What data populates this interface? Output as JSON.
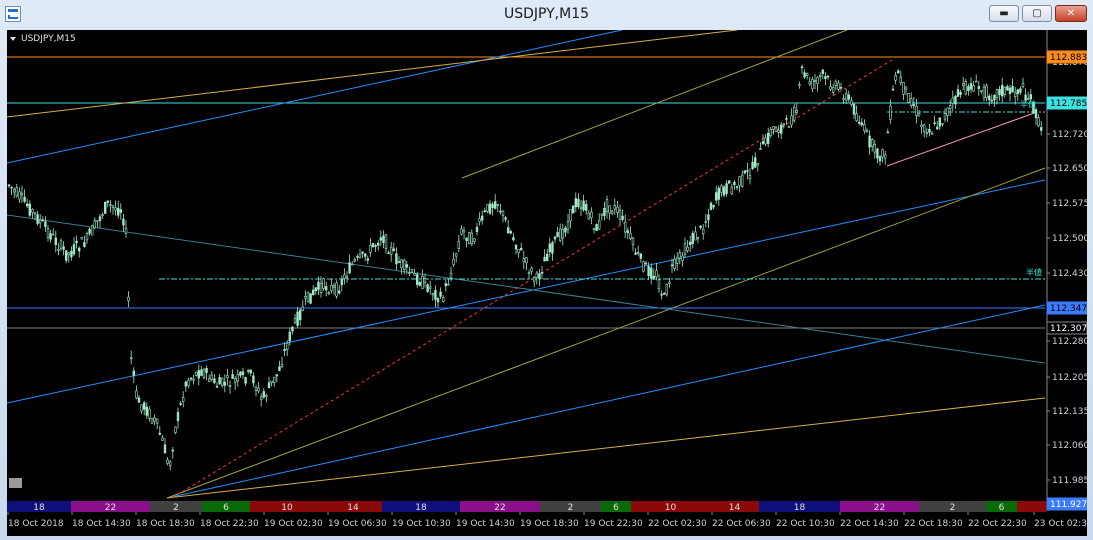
{
  "window": {
    "title": "USDJPY,M15",
    "buttons": {
      "minimize": "▬",
      "maximize": "▢",
      "close": "✕"
    }
  },
  "chart": {
    "symbol_label": "USDJPY,M15",
    "colors": {
      "background": "#000000",
      "candle": "#9fe8c8",
      "orange_line": "#ff8c1a",
      "cyan_line": "#40e0e0",
      "blue_line": "#3a7bff",
      "gray_line": "#808080",
      "trend_blue": "#1e90ff",
      "trend_yellow": "#d4b04a",
      "trend_olive": "#a0a040",
      "trend_teal": "#3b7d8f",
      "red_dotted": "#ff3030",
      "pink_line": "#ff9ac0",
      "grid": "#1a1a1a"
    },
    "price_axis": {
      "ticks": [
        "112.870",
        "112.720",
        "112.650",
        "112.575",
        "112.500",
        "112.430",
        "112.280",
        "112.205",
        "112.135",
        "112.060",
        "111.985",
        "111.915"
      ],
      "badges": [
        {
          "label": "112.883",
          "color": "#ff8c1a",
          "text_color": "#000000"
        },
        {
          "label": "112.785",
          "color": "#40e0e0",
          "text_color": "#000000"
        },
        {
          "label": "112.347",
          "color": "#3a7bff",
          "text_color": "#000000"
        },
        {
          "label": "112.307",
          "color": "#000000",
          "text_color": "#ffffff"
        },
        {
          "label": "111.927",
          "color": "#3a7bff",
          "text_color": "#ffffff"
        }
      ],
      "annotations": [
        "半値",
        "半値"
      ]
    },
    "time_axis": [
      "18 Oct 2018",
      "18 Oct 14:30",
      "18 Oct 18:30",
      "18 Oct 22:30",
      "19 Oct 02:30",
      "19 Oct 06:30",
      "19 Oct 10:30",
      "19 Oct 14:30",
      "19 Oct 18:30",
      "19 Oct 22:30",
      "22 Oct 02:30",
      "22 Oct 06:30",
      "22 Oct 10:30",
      "22 Oct 14:30",
      "22 Oct 18:30",
      "22 Oct 22:30",
      "23 Oct 02:30"
    ],
    "sessions": [
      {
        "label": "18",
        "color": "#10107a"
      },
      {
        "label": "22",
        "color": "#8a108a"
      },
      {
        "label": "2",
        "color": "#404040"
      },
      {
        "label": "6",
        "color": "#0a6a0a"
      },
      {
        "label": "10",
        "color": "#8a0a0a"
      },
      {
        "label": "14",
        "color": "#8a0a0a"
      },
      {
        "label": "18",
        "color": "#10107a"
      },
      {
        "label": "22",
        "color": "#8a108a"
      },
      {
        "label": "2",
        "color": "#404040"
      },
      {
        "label": "6",
        "color": "#0a6a0a"
      },
      {
        "label": "10",
        "color": "#8a0a0a"
      },
      {
        "label": "14",
        "color": "#8a0a0a"
      },
      {
        "label": "18",
        "color": "#10107a"
      },
      {
        "label": "22",
        "color": "#8a108a"
      },
      {
        "label": "2",
        "color": "#404040"
      },
      {
        "label": "6",
        "color": "#0a6a0a"
      },
      {
        "label": "",
        "color": "#8a0a0a"
      }
    ]
  }
}
